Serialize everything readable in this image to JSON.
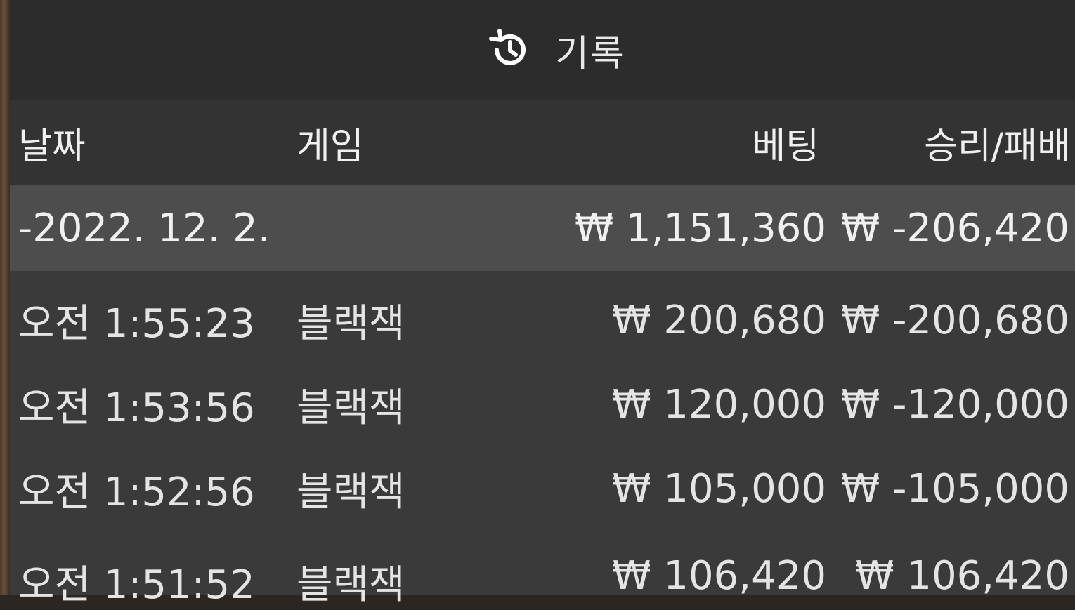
{
  "title": {
    "icon": "history-icon",
    "text": "기록"
  },
  "columns": {
    "date": "날짜",
    "game": "게임",
    "bet": "베팅",
    "result": "승리/패배"
  },
  "summary": {
    "date": "-2022. 12. 2.",
    "bet": "₩ 1,151,360",
    "result": "₩ -206,420"
  },
  "rows": [
    {
      "time": "오전 1:55:23",
      "game": "블랙잭",
      "bet": "₩ 200,680",
      "result": "₩ -200,680"
    },
    {
      "time": "오전 1:53:56",
      "game": "블랙잭",
      "bet": "₩ 120,000",
      "result": "₩ -120,000"
    },
    {
      "time": "오전 1:52:56",
      "game": "블랙잭",
      "bet": "₩ 105,000",
      "result": "₩ -105,000"
    },
    {
      "time": "오전 1:51:52",
      "game": "블랙잭",
      "bet": "₩ 106,420",
      "result": "₩ 106,420"
    }
  ],
  "colors": {
    "panel": "#3a3a3a",
    "titlebar": "#2c2c2c",
    "header": "#333333",
    "summary": "#4d4d4d",
    "text": "#e6e6e6"
  }
}
